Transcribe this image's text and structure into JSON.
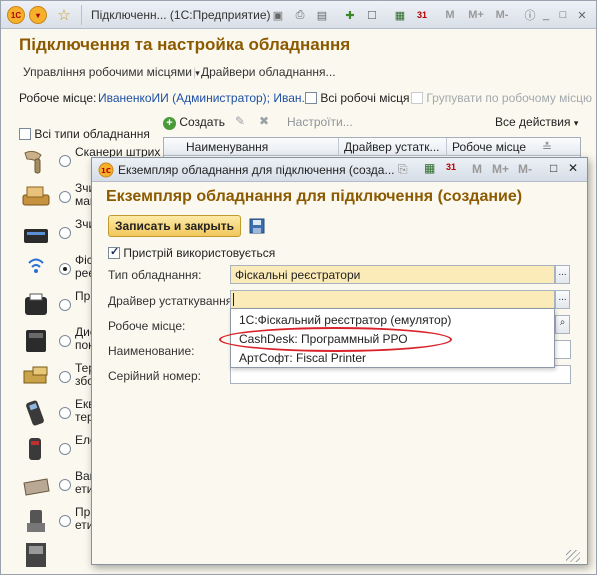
{
  "window": {
    "title": "Підключенн... (1С:Предприятие)",
    "toolbar_right_labels": [
      "M",
      "M+",
      "M-"
    ]
  },
  "main": {
    "heading": "Підключення та настройка обладнання",
    "commands": {
      "workplaces": "Управління робочими місцями",
      "drivers": "Драйвери обладнання..."
    },
    "workplace": {
      "label": "Робоче місце:",
      "value": "ИваненкоИИ (Администратор); Иван...",
      "all_places": "Всі робочі місця",
      "group_by": "Групувати по робочому місцю"
    },
    "types": {
      "all_label": "Всі типи обладнання",
      "items": [
        {
          "label": "Сканери штрих",
          "icon": "barcode-scanner-icon",
          "selected": false
        },
        {
          "label": "Зчитувачі магніт",
          "icon": "card-reader-icon",
          "selected": false
        },
        {
          "label": "Зчитувачі RFID",
          "icon": "rfid-reader-icon",
          "selected": false
        },
        {
          "label": "Фіскальні реєстр",
          "icon": "fiscal-printer-icon",
          "selected": true
        },
        {
          "label": "Принтери чеків",
          "icon": "receipt-printer-icon",
          "selected": false
        },
        {
          "label": "Дисплеї покупця",
          "icon": "customer-display-icon",
          "selected": false
        },
        {
          "label": "Термінали збору",
          "icon": "data-terminal-icon",
          "selected": false
        },
        {
          "label": "Еквайрингові термінали",
          "icon": "acquiring-terminal-icon",
          "selected": false
        },
        {
          "label": "Електронні ваги",
          "icon": "scale-icon",
          "selected": false
        },
        {
          "label": "Ваги з друком етикеток",
          "icon": "label-scale-icon",
          "selected": false
        },
        {
          "label": "Принтери етикеток",
          "icon": "label-printer-icon",
          "selected": false
        }
      ]
    },
    "table_toolbar": {
      "create": "Создать",
      "configure": "Настроїти...",
      "all_actions": "Все действия"
    },
    "table_columns": [
      "Наименування",
      "Драйвер устатк...",
      "Робоче місце"
    ]
  },
  "dialog": {
    "title": "Екземпляр обладнання для підключення (созда...",
    "heading": "Екземпляр обладнання для підключення (создание)",
    "save_close": "Записать и закрыть",
    "device_used": "Пристрій використовується",
    "fields": {
      "type_label": "Тип обладнання:",
      "type_value": "Фіскальні реєстратори",
      "driver_label": "Драйвер устаткування:",
      "driver_value": "",
      "workplace_label": "Робоче місце:",
      "name_label": "Наименование:",
      "serial_label": "Серійний номер:"
    },
    "driver_options": [
      "1С:Фіскальний реєстратор (емулятор)",
      "CashDesk: Программный РРО",
      "АртСофт: Fiscal Printer"
    ]
  },
  "colors": {
    "heading": "#8c5a00",
    "highlight_oval": "#d9222a",
    "save_button": "#f1c75b",
    "type_field": "#fbebb8"
  }
}
